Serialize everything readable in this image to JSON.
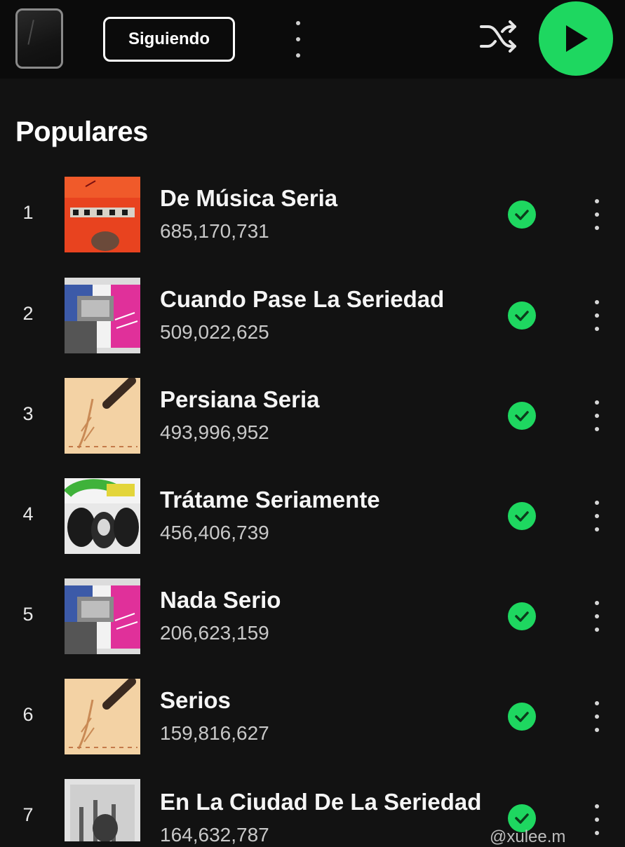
{
  "header": {
    "follow_label": "Siguiendo",
    "icons": {
      "more": "more-vertical-icon",
      "shuffle": "shuffle-icon",
      "play": "play-icon"
    },
    "accent_color": "#1ed760"
  },
  "section": {
    "title": "Populares"
  },
  "tracks": [
    {
      "number": "1",
      "title": "De Música Seria",
      "plays": "685,170,731",
      "downloaded": true,
      "cover": "cover-red"
    },
    {
      "number": "2",
      "title": "Cuando Pase La Seriedad",
      "plays": "509,022,625",
      "downloaded": true,
      "cover": "cover-collage"
    },
    {
      "number": "3",
      "title": "Persiana Seria",
      "plays": "493,996,952",
      "downloaded": true,
      "cover": "cover-beige"
    },
    {
      "number": "4",
      "title": "Trátame  Seriamente",
      "plays": "456,406,739",
      "downloaded": true,
      "cover": "cover-soda"
    },
    {
      "number": "5",
      "title": "Nada Serio",
      "plays": "206,623,159",
      "downloaded": true,
      "cover": "cover-collage"
    },
    {
      "number": "6",
      "title": " Serios",
      "plays": "159,816,627",
      "downloaded": true,
      "cover": "cover-beige"
    },
    {
      "number": "7",
      "title": "En La Ciudad De La Seriedad",
      "plays": "164,632,787",
      "downloaded": true,
      "cover": "cover-bw"
    }
  ],
  "watermark": "@xulee.m"
}
